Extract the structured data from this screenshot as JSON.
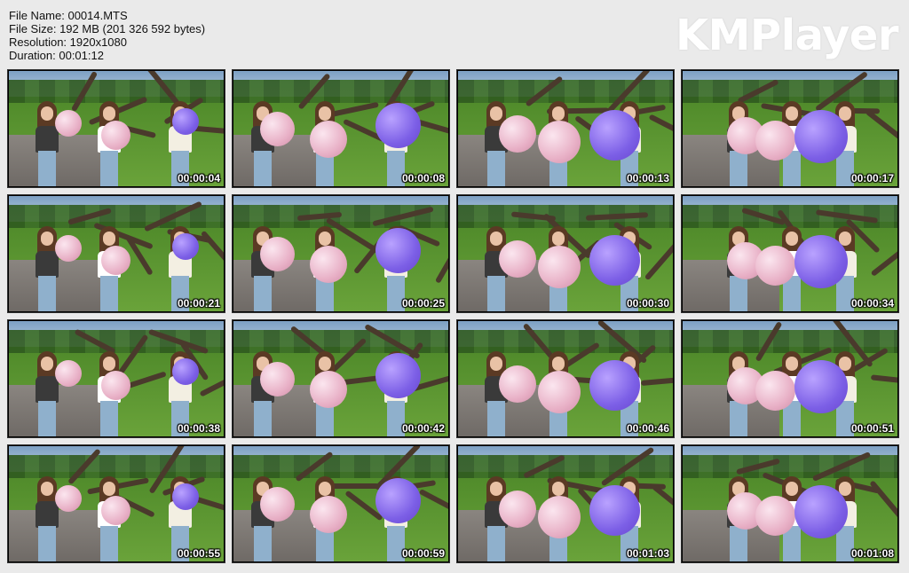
{
  "file_info": {
    "name": "File Name: 00014.MTS",
    "size": "File Size: 192 MB (201 326 592 bytes)",
    "resolution": "Resolution: 1920x1080",
    "duration": "Duration: 00:01:12"
  },
  "brand": "KMPlayer",
  "thumbnails": [
    {
      "time": "00:00:04"
    },
    {
      "time": "00:00:08"
    },
    {
      "time": "00:00:13"
    },
    {
      "time": "00:00:17"
    },
    {
      "time": "00:00:21"
    },
    {
      "time": "00:00:25"
    },
    {
      "time": "00:00:30"
    },
    {
      "time": "00:00:34"
    },
    {
      "time": "00:00:38"
    },
    {
      "time": "00:00:42"
    },
    {
      "time": "00:00:46"
    },
    {
      "time": "00:00:51"
    },
    {
      "time": "00:00:55"
    },
    {
      "time": "00:00:59"
    },
    {
      "time": "00:01:03"
    },
    {
      "time": "00:01:08"
    }
  ]
}
